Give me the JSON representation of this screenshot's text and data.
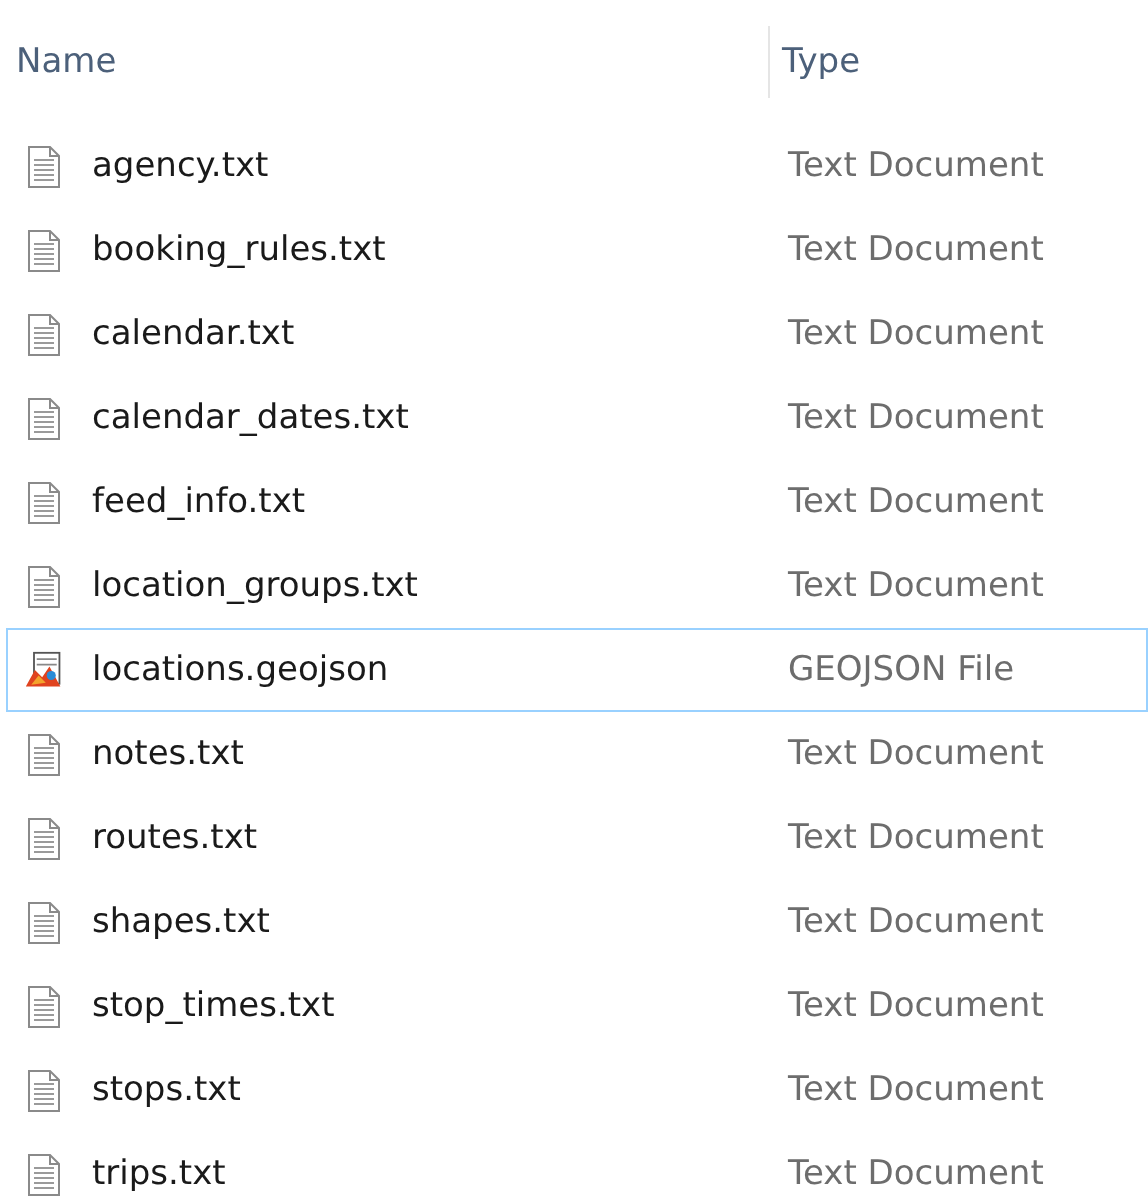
{
  "columns": [
    "Name",
    "Type"
  ],
  "rows": [
    {
      "name": "agency.txt",
      "type": "Text Document",
      "kind": "document",
      "selected": false
    },
    {
      "name": "booking_rules.txt",
      "type": "Text Document",
      "kind": "document",
      "selected": false
    },
    {
      "name": "calendar.txt",
      "type": "Text Document",
      "kind": "document",
      "selected": false
    },
    {
      "name": "calendar_dates.txt",
      "type": "Text Document",
      "kind": "document",
      "selected": false
    },
    {
      "name": "feed_info.txt",
      "type": "Text Document",
      "kind": "document",
      "selected": false
    },
    {
      "name": "location_groups.txt",
      "type": "Text Document",
      "kind": "document",
      "selected": false
    },
    {
      "name": "locations.geojson",
      "type": "GEOJSON File",
      "kind": "geojson",
      "selected": true
    },
    {
      "name": "notes.txt",
      "type": "Text Document",
      "kind": "document",
      "selected": false
    },
    {
      "name": "routes.txt",
      "type": "Text Document",
      "kind": "document",
      "selected": false
    },
    {
      "name": "shapes.txt",
      "type": "Text Document",
      "kind": "document",
      "selected": false
    },
    {
      "name": "stop_times.txt",
      "type": "Text Document",
      "kind": "document",
      "selected": false
    },
    {
      "name": "stops.txt",
      "type": "Text Document",
      "kind": "document",
      "selected": false
    },
    {
      "name": "trips.txt",
      "type": "Text Document",
      "kind": "document",
      "selected": false
    }
  ]
}
